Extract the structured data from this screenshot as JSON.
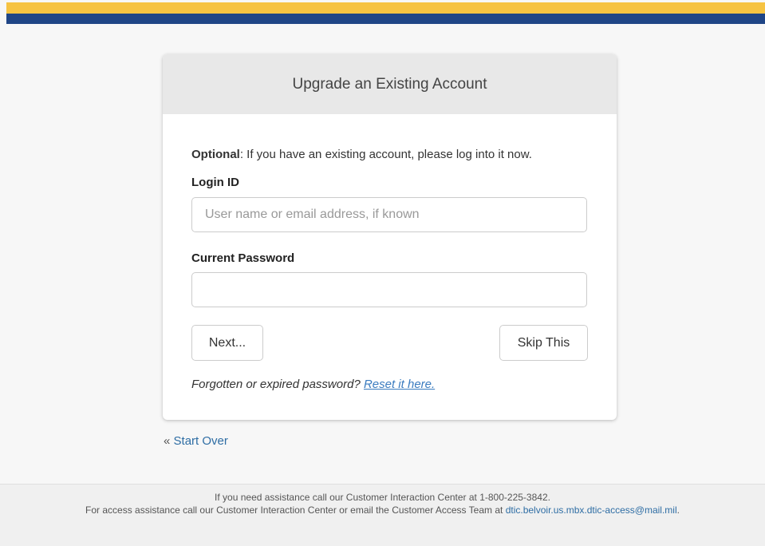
{
  "colors": {
    "top_bar_gold": "#f6c342",
    "top_bar_blue": "#1f4586",
    "link": "#3a7bbf"
  },
  "panel": {
    "title": "Upgrade an Existing Account",
    "intro_bold": "Optional",
    "intro_text": ": If you have an existing account, please log into it now.",
    "login_label": "Login ID",
    "login_placeholder": "User name or email address, if known",
    "login_value": "",
    "password_label": "Current Password",
    "password_value": "",
    "next_button": "Next...",
    "skip_button": "Skip This",
    "forgot_text": "Forgotten or expired password? ",
    "reset_link": "Reset it here."
  },
  "nav": {
    "back_glyph": "«",
    "start_over": "Start Over"
  },
  "footer": {
    "line1": "If you need assistance call our Customer Interaction Center at 1-800-225-3842.",
    "line2_text": "For access assistance call our Customer Interaction Center or email the Customer Access Team at ",
    "email_link": "dtic.belvoir.us.mbx.dtic-access@mail.mil",
    "line2_end": "."
  }
}
